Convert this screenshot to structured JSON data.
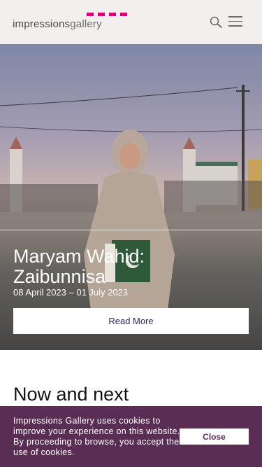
{
  "header": {
    "logo_word1": "impressions",
    "logo_word2": "gallery",
    "search_icon": "search-icon",
    "menu_icon": "hamburger-menu-icon"
  },
  "hero": {
    "title": "Maryam Wahid: Zaibunnisa",
    "dates": "08 April 2023 – 01 July 2023",
    "read_more_label": "Read More"
  },
  "section": {
    "heading": "Now and next"
  },
  "cookie_banner": {
    "message": "Impressions Gallery uses cookies to improve your experience on this website. By proceeding to browse, you accept the use of cookies.",
    "close_label": "Close"
  },
  "colors": {
    "brand_magenta": "#d6007d",
    "cookie_bg": "#5a2d54",
    "header_bg": "#f2efec",
    "button_text": "#2b2660"
  }
}
